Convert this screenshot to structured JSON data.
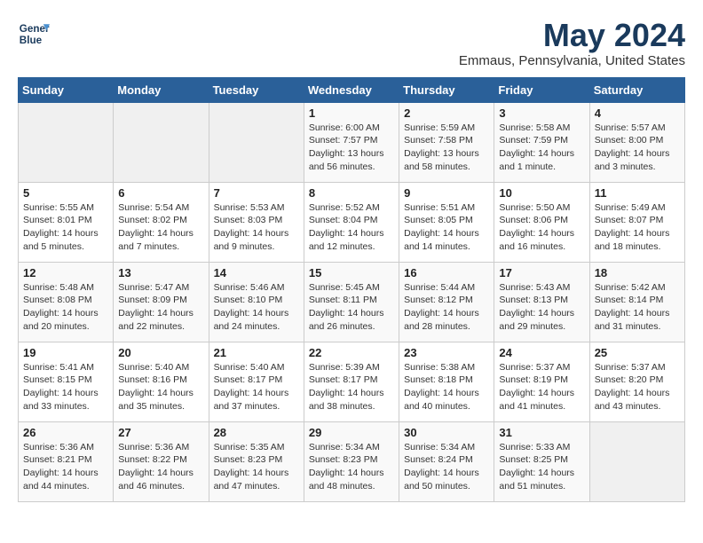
{
  "header": {
    "logo_line1": "General",
    "logo_line2": "Blue",
    "month_title": "May 2024",
    "location": "Emmaus, Pennsylvania, United States"
  },
  "weekdays": [
    "Sunday",
    "Monday",
    "Tuesday",
    "Wednesday",
    "Thursday",
    "Friday",
    "Saturday"
  ],
  "weeks": [
    [
      {
        "day": "",
        "info": ""
      },
      {
        "day": "",
        "info": ""
      },
      {
        "day": "",
        "info": ""
      },
      {
        "day": "1",
        "info": "Sunrise: 6:00 AM\nSunset: 7:57 PM\nDaylight: 13 hours and 56 minutes."
      },
      {
        "day": "2",
        "info": "Sunrise: 5:59 AM\nSunset: 7:58 PM\nDaylight: 13 hours and 58 minutes."
      },
      {
        "day": "3",
        "info": "Sunrise: 5:58 AM\nSunset: 7:59 PM\nDaylight: 14 hours and 1 minute."
      },
      {
        "day": "4",
        "info": "Sunrise: 5:57 AM\nSunset: 8:00 PM\nDaylight: 14 hours and 3 minutes."
      }
    ],
    [
      {
        "day": "5",
        "info": "Sunrise: 5:55 AM\nSunset: 8:01 PM\nDaylight: 14 hours and 5 minutes."
      },
      {
        "day": "6",
        "info": "Sunrise: 5:54 AM\nSunset: 8:02 PM\nDaylight: 14 hours and 7 minutes."
      },
      {
        "day": "7",
        "info": "Sunrise: 5:53 AM\nSunset: 8:03 PM\nDaylight: 14 hours and 9 minutes."
      },
      {
        "day": "8",
        "info": "Sunrise: 5:52 AM\nSunset: 8:04 PM\nDaylight: 14 hours and 12 minutes."
      },
      {
        "day": "9",
        "info": "Sunrise: 5:51 AM\nSunset: 8:05 PM\nDaylight: 14 hours and 14 minutes."
      },
      {
        "day": "10",
        "info": "Sunrise: 5:50 AM\nSunset: 8:06 PM\nDaylight: 14 hours and 16 minutes."
      },
      {
        "day": "11",
        "info": "Sunrise: 5:49 AM\nSunset: 8:07 PM\nDaylight: 14 hours and 18 minutes."
      }
    ],
    [
      {
        "day": "12",
        "info": "Sunrise: 5:48 AM\nSunset: 8:08 PM\nDaylight: 14 hours and 20 minutes."
      },
      {
        "day": "13",
        "info": "Sunrise: 5:47 AM\nSunset: 8:09 PM\nDaylight: 14 hours and 22 minutes."
      },
      {
        "day": "14",
        "info": "Sunrise: 5:46 AM\nSunset: 8:10 PM\nDaylight: 14 hours and 24 minutes."
      },
      {
        "day": "15",
        "info": "Sunrise: 5:45 AM\nSunset: 8:11 PM\nDaylight: 14 hours and 26 minutes."
      },
      {
        "day": "16",
        "info": "Sunrise: 5:44 AM\nSunset: 8:12 PM\nDaylight: 14 hours and 28 minutes."
      },
      {
        "day": "17",
        "info": "Sunrise: 5:43 AM\nSunset: 8:13 PM\nDaylight: 14 hours and 29 minutes."
      },
      {
        "day": "18",
        "info": "Sunrise: 5:42 AM\nSunset: 8:14 PM\nDaylight: 14 hours and 31 minutes."
      }
    ],
    [
      {
        "day": "19",
        "info": "Sunrise: 5:41 AM\nSunset: 8:15 PM\nDaylight: 14 hours and 33 minutes."
      },
      {
        "day": "20",
        "info": "Sunrise: 5:40 AM\nSunset: 8:16 PM\nDaylight: 14 hours and 35 minutes."
      },
      {
        "day": "21",
        "info": "Sunrise: 5:40 AM\nSunset: 8:17 PM\nDaylight: 14 hours and 37 minutes."
      },
      {
        "day": "22",
        "info": "Sunrise: 5:39 AM\nSunset: 8:17 PM\nDaylight: 14 hours and 38 minutes."
      },
      {
        "day": "23",
        "info": "Sunrise: 5:38 AM\nSunset: 8:18 PM\nDaylight: 14 hours and 40 minutes."
      },
      {
        "day": "24",
        "info": "Sunrise: 5:37 AM\nSunset: 8:19 PM\nDaylight: 14 hours and 41 minutes."
      },
      {
        "day": "25",
        "info": "Sunrise: 5:37 AM\nSunset: 8:20 PM\nDaylight: 14 hours and 43 minutes."
      }
    ],
    [
      {
        "day": "26",
        "info": "Sunrise: 5:36 AM\nSunset: 8:21 PM\nDaylight: 14 hours and 44 minutes."
      },
      {
        "day": "27",
        "info": "Sunrise: 5:36 AM\nSunset: 8:22 PM\nDaylight: 14 hours and 46 minutes."
      },
      {
        "day": "28",
        "info": "Sunrise: 5:35 AM\nSunset: 8:23 PM\nDaylight: 14 hours and 47 minutes."
      },
      {
        "day": "29",
        "info": "Sunrise: 5:34 AM\nSunset: 8:23 PM\nDaylight: 14 hours and 48 minutes."
      },
      {
        "day": "30",
        "info": "Sunrise: 5:34 AM\nSunset: 8:24 PM\nDaylight: 14 hours and 50 minutes."
      },
      {
        "day": "31",
        "info": "Sunrise: 5:33 AM\nSunset: 8:25 PM\nDaylight: 14 hours and 51 minutes."
      },
      {
        "day": "",
        "info": ""
      }
    ]
  ]
}
